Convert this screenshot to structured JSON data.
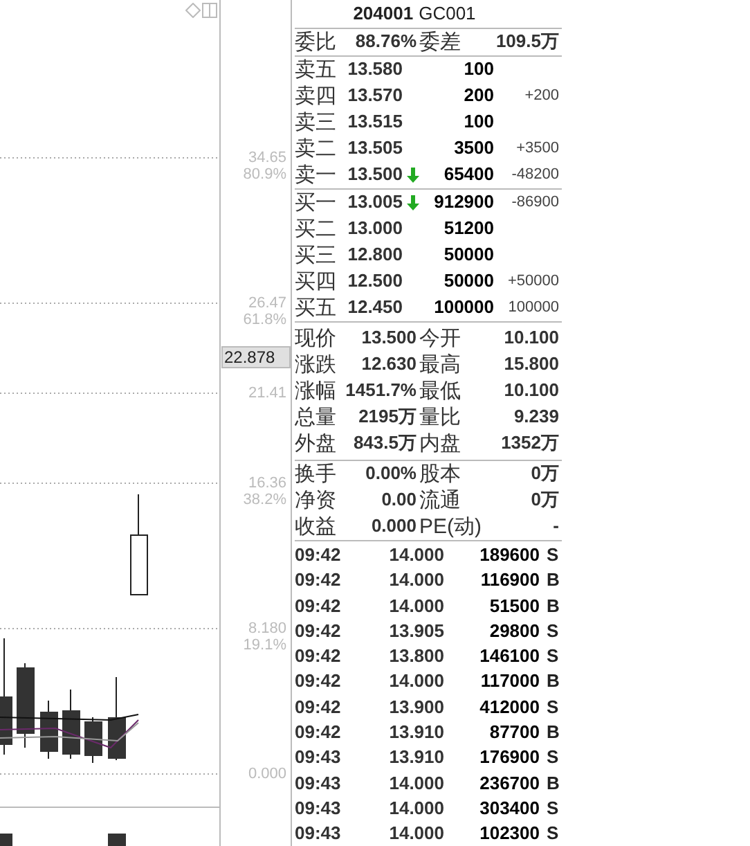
{
  "chart": {
    "axis_labels": [
      {
        "value": "34.65",
        "percent": "80.9%"
      },
      {
        "value": "26.47",
        "percent": "61.8%"
      },
      {
        "value": "21.41"
      },
      {
        "value": "16.36",
        "percent": "38.2%"
      },
      {
        "value": "8.180",
        "percent": "19.1%"
      },
      {
        "value": "0.000"
      }
    ],
    "cursor_price": "22.878"
  },
  "quote": {
    "code": "204001",
    "name": "GC001",
    "ratio": {
      "label": "委比",
      "value": "88.76%",
      "diff_label": "委差",
      "diff_value": "109.5万"
    },
    "sell": [
      {
        "label": "卖五",
        "price": "13.580",
        "volume": "100"
      },
      {
        "label": "卖四",
        "price": "13.570",
        "volume": "200",
        "change": "+200"
      },
      {
        "label": "卖三",
        "price": "13.515",
        "volume": "100"
      },
      {
        "label": "卖二",
        "price": "13.505",
        "volume": "3500",
        "change": "+3500"
      },
      {
        "label": "卖一",
        "price": "13.500",
        "volume": "65400",
        "change": "-48200",
        "falling": true
      }
    ],
    "buy": [
      {
        "label": "买一",
        "price": "13.005",
        "volume": "912900",
        "change": "-86900",
        "falling": true
      },
      {
        "label": "买二",
        "price": "13.000",
        "volume": "51200"
      },
      {
        "label": "买三",
        "price": "12.800",
        "volume": "50000"
      },
      {
        "label": "买四",
        "price": "12.500",
        "volume": "50000",
        "change": "+50000"
      },
      {
        "label": "买五",
        "price": "12.450",
        "volume": "100000",
        "change": "100000"
      }
    ],
    "stats": [
      {
        "label": "现价",
        "value": "13.500",
        "label2": "今开",
        "value2": "10.100"
      },
      {
        "label": "涨跌",
        "value": "12.630",
        "label2": "最高",
        "value2": "15.800"
      },
      {
        "label": "涨幅",
        "value": "1451.7%",
        "label2": "最低",
        "value2": "10.100"
      },
      {
        "label": "总量",
        "value": "2195万",
        "label2": "量比",
        "value2": "9.239"
      },
      {
        "label": "外盘",
        "value": "843.5万",
        "label2": "内盘",
        "value2": "1352万"
      }
    ],
    "finance": [
      {
        "label": "换手",
        "value": "0.00%",
        "label2": "股本",
        "value2": "0万"
      },
      {
        "label": "净资",
        "value": "0.00",
        "label2": "流通",
        "value2": "0万"
      },
      {
        "label": "收益",
        "value": "0.000",
        "label2": "PE(动)",
        "value2": "-"
      }
    ],
    "trades": [
      {
        "time": "09:42",
        "price": "14.000",
        "volume": "189600",
        "side": "S"
      },
      {
        "time": "09:42",
        "price": "14.000",
        "volume": "116900",
        "side": "B"
      },
      {
        "time": "09:42",
        "price": "14.000",
        "volume": "51500",
        "side": "B"
      },
      {
        "time": "09:42",
        "price": "13.905",
        "volume": "29800",
        "side": "S"
      },
      {
        "time": "09:42",
        "price": "13.800",
        "volume": "146100",
        "side": "S"
      },
      {
        "time": "09:42",
        "price": "14.000",
        "volume": "117000",
        "side": "B"
      },
      {
        "time": "09:42",
        "price": "13.900",
        "volume": "412000",
        "side": "S"
      },
      {
        "time": "09:42",
        "price": "13.910",
        "volume": "87700",
        "side": "B"
      },
      {
        "time": "09:43",
        "price": "13.910",
        "volume": "176900",
        "side": "S"
      },
      {
        "time": "09:43",
        "price": "14.000",
        "volume": "236700",
        "side": "B"
      },
      {
        "time": "09:43",
        "price": "14.000",
        "volume": "303400",
        "side": "S"
      },
      {
        "time": "09:43",
        "price": "14.000",
        "volume": "102300",
        "side": "S"
      }
    ]
  }
}
